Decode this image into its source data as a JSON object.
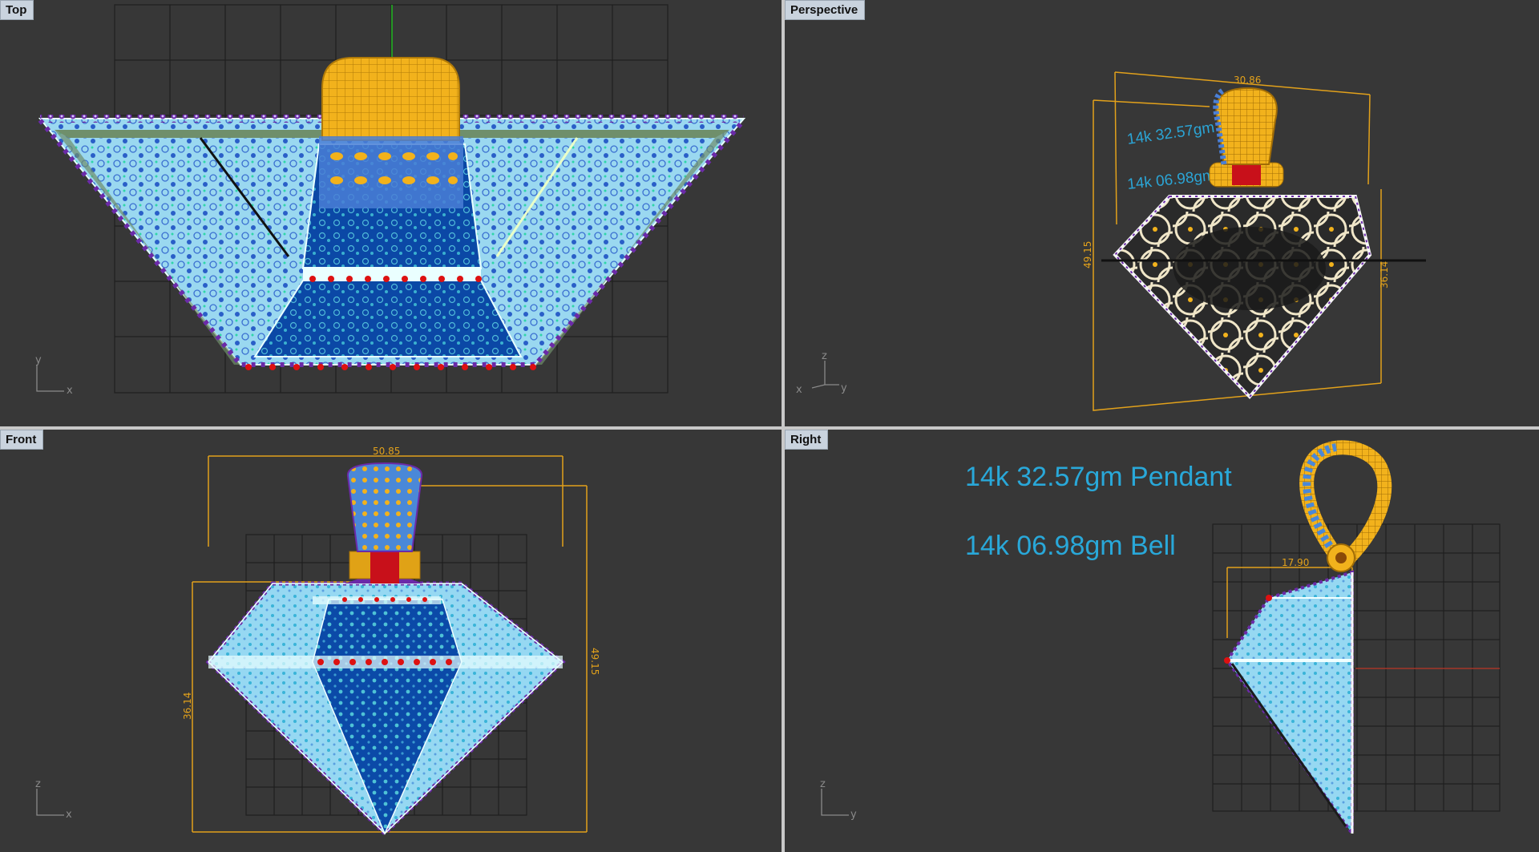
{
  "viewports": {
    "top": {
      "label": "Top",
      "axis_h": "x",
      "axis_v": "y"
    },
    "perspective": {
      "label": "Perspective",
      "axis_h": "y",
      "axis_v": "z",
      "axis_h2": "x",
      "dim_width": "30.86",
      "dim_height_left": "49.15",
      "dim_height_right": "36.14",
      "note_pendant": "14k 32.57gm Pendant",
      "note_bell": "14k 06.98gm Bell"
    },
    "front": {
      "label": "Front",
      "axis_h": "x",
      "axis_v": "z",
      "dim_width": "50.85",
      "dim_height_left": "36.14",
      "dim_height_right": "49.15"
    },
    "right": {
      "label": "Right",
      "axis_h": "y",
      "axis_v": "z",
      "dim_depth": "17.90",
      "note_pendant": "14k 32.57gm Pendant",
      "note_bell": "14k 06.98gm Bell"
    }
  },
  "colors": {
    "viewport_bg": "#373737",
    "grid": "#1f1f1f",
    "gold": "#f2b21c",
    "light_blue": "#8fd6f0",
    "dark_blue": "#0d4aa8",
    "dimension": "#e2a11b",
    "annotation": "#29a8d9",
    "label_bg": "#c9d3de"
  }
}
